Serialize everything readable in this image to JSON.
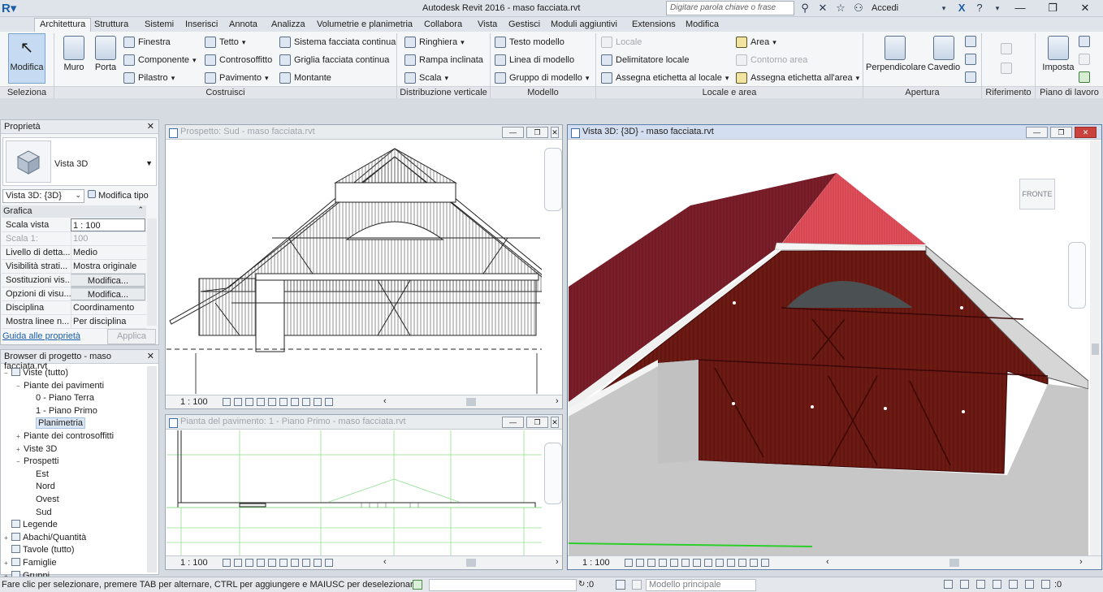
{
  "app": {
    "title": "Autodesk Revit 2016 -    maso facciata.rvt",
    "search_placeholder": "Digitare parola chiave o frase",
    "signin": "Accedi"
  },
  "tabs": [
    "Architettura",
    "Struttura",
    "Sistemi",
    "Inserisci",
    "Annota",
    "Analizza",
    "Volumetrie e planimetria",
    "Collabora",
    "Vista",
    "Gestisci",
    "Moduli aggiuntivi",
    "Extensions",
    "Modifica"
  ],
  "ribbon": {
    "modifica": "Modifica",
    "muro": "Muro",
    "porta": "Porta",
    "costruisci": [
      "Finestra",
      "Componente",
      "Pilastro",
      "Tetto",
      "Controsoffitto",
      "Pavimento",
      "Sistema facciata continua",
      "Griglia facciata continua",
      "Montante"
    ],
    "distribuzione": [
      "Ringhiera",
      "Rampa inclinata",
      "Scala"
    ],
    "modello": [
      "Testo modello",
      "Linea di modello",
      "Gruppo di modello"
    ],
    "locale": [
      "Locale",
      "Delimitatore locale",
      "Assegna etichetta  al locale",
      "Area",
      "Contorno  area",
      "Assegna etichetta  all'area"
    ],
    "perpendicolare": "Perpendicolare",
    "cavedio": "Cavedio",
    "imposta": "Imposta",
    "panels": [
      "Seleziona",
      "Costruisci",
      "Distribuzione verticale",
      "Modello",
      "Locale e area",
      "Apertura",
      "Riferimento",
      "Piano di lavoro"
    ]
  },
  "properties": {
    "title": "Proprietà",
    "type_name": "Vista 3D",
    "view_selector": "Vista 3D: {3D}",
    "edit_type": "Modifica tipo",
    "group": "Grafica",
    "rows": [
      {
        "k": "Scala vista",
        "v": "1 : 100"
      },
      {
        "k": "Scala  1:",
        "v": "100"
      },
      {
        "k": "Livello di detta...",
        "v": "Medio"
      },
      {
        "k": "Visibilità strati...",
        "v": "Mostra originale"
      },
      {
        "k": "Sostituzioni vis...",
        "v": "Modifica..."
      },
      {
        "k": "Opzioni di visu...",
        "v": "Modifica..."
      },
      {
        "k": "Disciplina",
        "v": "Coordinamento"
      },
      {
        "k": "Mostra linee n...",
        "v": "Per disciplina"
      }
    ],
    "help_link": "Guida alle proprietà",
    "apply": "Applica"
  },
  "browser": {
    "title": "Browser di progetto - maso facciata.rvt",
    "items": [
      {
        "label": "Viste (tutto)",
        "level": 0,
        "twist": "−"
      },
      {
        "label": "Piante dei pavimenti",
        "level": 1,
        "twist": "−"
      },
      {
        "label": "0 - Piano Terra",
        "level": 2,
        "twist": ""
      },
      {
        "label": "1 - Piano Primo",
        "level": 2,
        "twist": ""
      },
      {
        "label": "Planimetria",
        "level": 2,
        "twist": ""
      },
      {
        "label": "Piante dei controsoffitti",
        "level": 1,
        "twist": "+"
      },
      {
        "label": "Viste 3D",
        "level": 1,
        "twist": "+"
      },
      {
        "label": "Prospetti",
        "level": 1,
        "twist": "−"
      },
      {
        "label": "Est",
        "level": 2,
        "twist": ""
      },
      {
        "label": "Nord",
        "level": 2,
        "twist": ""
      },
      {
        "label": "Ovest",
        "level": 2,
        "twist": ""
      },
      {
        "label": "Sud",
        "level": 2,
        "twist": ""
      },
      {
        "label": "Legende",
        "level": 0,
        "twist": ""
      },
      {
        "label": "Abachi/Quantità",
        "level": 0,
        "twist": "+"
      },
      {
        "label": "Tavole (tutto)",
        "level": 0,
        "twist": ""
      },
      {
        "label": "Famiglie",
        "level": 0,
        "twist": "+"
      },
      {
        "label": "Gruppi",
        "level": 0,
        "twist": "+"
      }
    ]
  },
  "views": {
    "south": {
      "title": "Prospetto: Sud - maso facciata.rvt",
      "scale": "1 : 100"
    },
    "plan": {
      "title": "Pianta del pavimento: 1 - Piano Primo - maso facciata.rvt",
      "scale": "1 : 100"
    },
    "view3d": {
      "title": "Vista 3D: {3D} - maso facciata.rvt",
      "scale": "1 : 100",
      "viewcube": "FRONTE"
    }
  },
  "status": {
    "message": "Fare clic per selezionare, premere TAB per alternare, CTRL per aggiungere e MAIUSC per deselezionare.",
    "zero": ":0",
    "model": "Modello principale",
    "filter": ":0"
  },
  "colors": {
    "roof_red": "#e0505b",
    "wood": "#6e1a14",
    "wall": "#c7c7c8",
    "accent": "#1b5ea8"
  }
}
